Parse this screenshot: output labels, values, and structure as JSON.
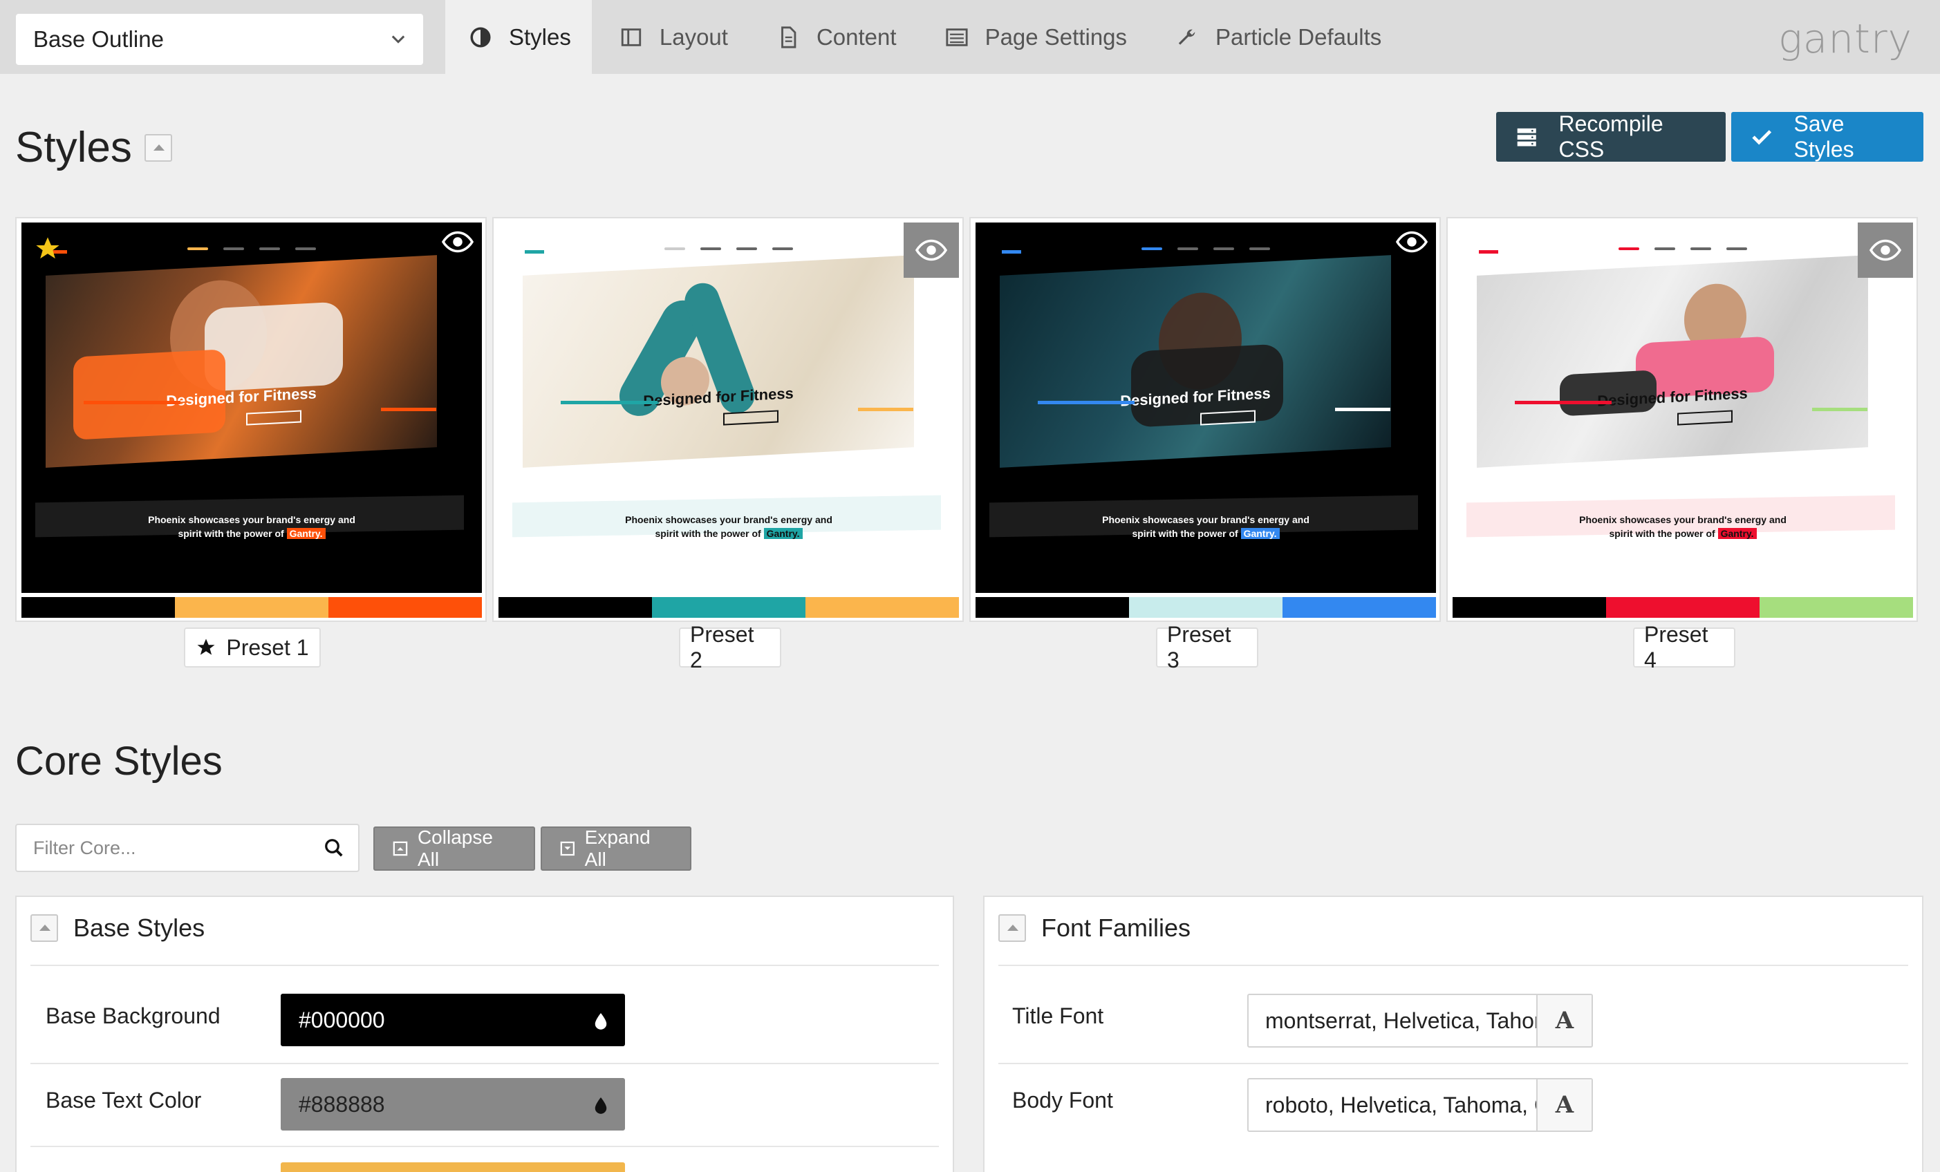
{
  "outline": {
    "selected": "Base Outline"
  },
  "tabs": [
    {
      "label": "Styles",
      "icon": "contrast-icon",
      "active": true
    },
    {
      "label": "Layout",
      "icon": "layout-icon",
      "active": false
    },
    {
      "label": "Content",
      "icon": "document-icon",
      "active": false
    },
    {
      "label": "Page Settings",
      "icon": "page-settings-icon",
      "active": false
    },
    {
      "label": "Particle Defaults",
      "icon": "wrench-icon",
      "active": false
    }
  ],
  "logo": "gantry",
  "page": {
    "title": "Styles"
  },
  "actions": {
    "recompile": "Recompile CSS",
    "save": "Save Styles"
  },
  "preset_thumbnail": {
    "hero_title": "Designed for Fitness",
    "tagline_line1": "Phoenix showcases your brand's energy and",
    "tagline_line2": "spirit with the power of",
    "highlight": "Gantry."
  },
  "presets": [
    {
      "label": "Preset 1",
      "active": true,
      "colors": [
        "#000000",
        "#fbb54c",
        "#fe5009"
      ]
    },
    {
      "label": "Preset 2",
      "active": false,
      "colors": [
        "#000000",
        "#1fa5a5",
        "#fbb54c"
      ]
    },
    {
      "label": "Preset 3",
      "active": false,
      "colors": [
        "#000000",
        "#c8ecec",
        "#3388f0"
      ]
    },
    {
      "label": "Preset 4",
      "active": false,
      "colors": [
        "#000000",
        "#ee0f2e",
        "#a6de7e"
      ]
    }
  ],
  "core": {
    "title": "Core Styles",
    "filter_placeholder": "Filter Core...",
    "collapse_all": "Collapse All",
    "expand_all": "Expand All"
  },
  "base_styles": {
    "title": "Base Styles",
    "background_label": "Base Background",
    "background_value": "#000000",
    "text_color_label": "Base Text Color",
    "text_color_value": "#888888"
  },
  "font_families": {
    "title": "Font Families",
    "title_font_label": "Title Font",
    "title_font_value": "montserrat, Helvetica, Tahoma, Geneva, Arial, sans-serif",
    "body_font_label": "Body Font",
    "body_font_value": "roboto, Helvetica, Tahoma, Geneva, Arial, sans-serif"
  }
}
